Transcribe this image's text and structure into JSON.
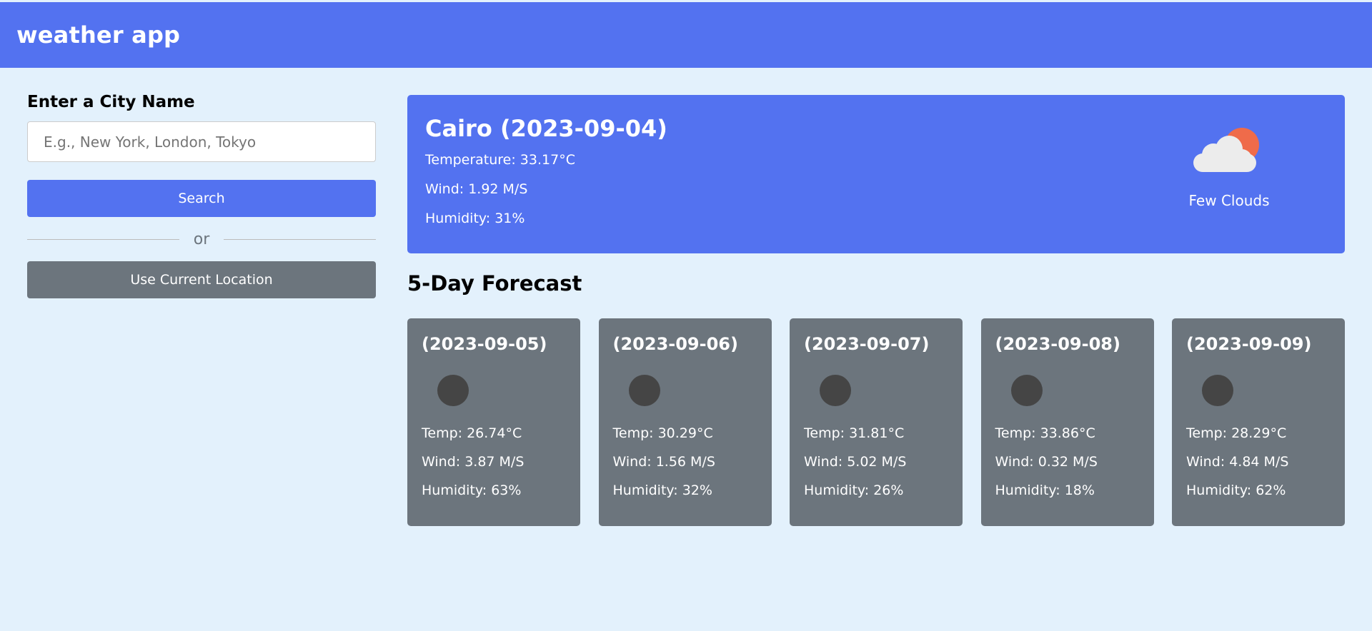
{
  "header": {
    "title": "weather app"
  },
  "search": {
    "label": "Enter a City Name",
    "value": "",
    "placeholder": "E.g., New York, London, Tokyo",
    "search_button": "Search",
    "divider_text": "or",
    "location_button": "Use Current Location"
  },
  "current": {
    "title": "Cairo (2023-09-04)",
    "temperature": "Temperature: 33.17°C",
    "wind": "Wind: 1.92 M/S",
    "humidity": "Humidity: 31%",
    "icon": "few-clouds-icon",
    "condition": "Few Clouds"
  },
  "forecast": {
    "title": "5-Day Forecast",
    "days": [
      {
        "date": "(2023-09-05)",
        "icon": "weather-icon",
        "temp": "Temp: 26.74°C",
        "wind": "Wind: 3.87 M/S",
        "humidity": "Humidity: 63%"
      },
      {
        "date": "(2023-09-06)",
        "icon": "weather-icon",
        "temp": "Temp: 30.29°C",
        "wind": "Wind: 1.56 M/S",
        "humidity": "Humidity: 32%"
      },
      {
        "date": "(2023-09-07)",
        "icon": "weather-icon",
        "temp": "Temp: 31.81°C",
        "wind": "Wind: 5.02 M/S",
        "humidity": "Humidity: 26%"
      },
      {
        "date": "(2023-09-08)",
        "icon": "weather-icon",
        "temp": "Temp: 33.86°C",
        "wind": "Wind: 0.32 M/S",
        "humidity": "Humidity: 18%"
      },
      {
        "date": "(2023-09-09)",
        "icon": "weather-icon",
        "temp": "Temp: 28.29°C",
        "wind": "Wind: 4.84 M/S",
        "humidity": "Humidity: 62%"
      }
    ]
  },
  "colors": {
    "primary": "#5372f0",
    "secondary": "#6c757d",
    "background": "#e3f1fc",
    "sun": "#ef6b4a",
    "cloud": "#ececec",
    "icon_placeholder": "#454545"
  }
}
